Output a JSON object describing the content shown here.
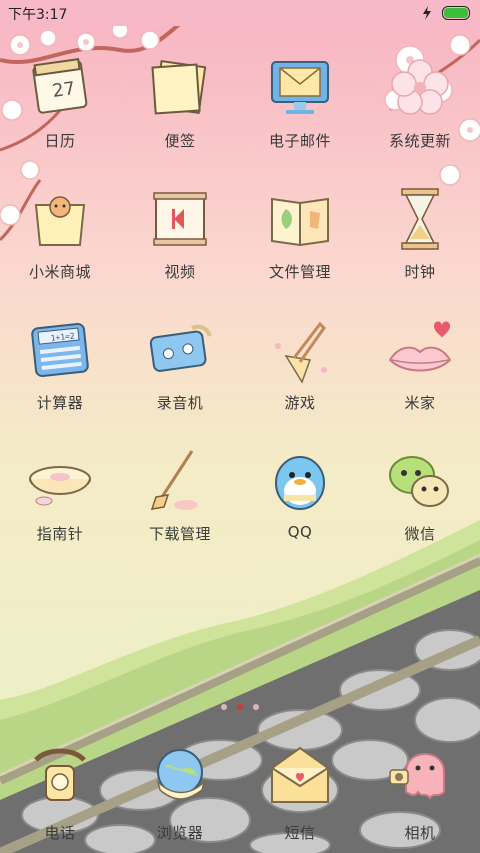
{
  "status_bar": {
    "time": "下午3:17",
    "battery_level": 1.0,
    "icons": [
      "charging-bolt-icon",
      "battery-icon"
    ]
  },
  "apps": [
    {
      "id": "calendar",
      "label": "日历",
      "day": "27"
    },
    {
      "id": "notes",
      "label": "便签"
    },
    {
      "id": "email",
      "label": "电子邮件"
    },
    {
      "id": "system-update",
      "label": "系统更新"
    },
    {
      "id": "mi-store",
      "label": "小米商城"
    },
    {
      "id": "video",
      "label": "视频"
    },
    {
      "id": "file-manager",
      "label": "文件管理"
    },
    {
      "id": "clock",
      "label": "时钟"
    },
    {
      "id": "calculator",
      "label": "计算器",
      "display": "1+1=2"
    },
    {
      "id": "recorder",
      "label": "录音机"
    },
    {
      "id": "games",
      "label": "游戏"
    },
    {
      "id": "mi-home",
      "label": "米家"
    },
    {
      "id": "compass",
      "label": "指南针"
    },
    {
      "id": "downloads",
      "label": "下载管理"
    },
    {
      "id": "qq",
      "label": "QQ"
    },
    {
      "id": "wechat",
      "label": "微信"
    }
  ],
  "page_indicator": {
    "pages": 3,
    "current": 2
  },
  "dock": [
    {
      "id": "phone",
      "label": "电话"
    },
    {
      "id": "browser",
      "label": "浏览器"
    },
    {
      "id": "sms",
      "label": "短信"
    },
    {
      "id": "camera",
      "label": "相机"
    }
  ]
}
